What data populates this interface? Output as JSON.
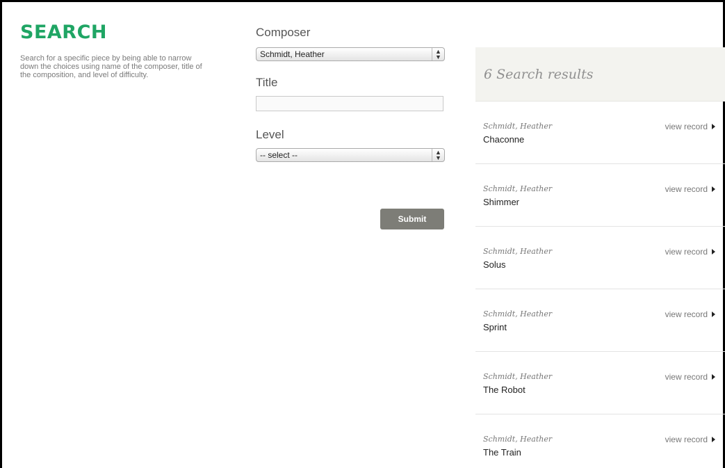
{
  "intro": {
    "heading": "SEARCH",
    "description": "Search for a specific piece by being able to narrow down the choices using name of the composer, title of the composition, and level of difficulty."
  },
  "form": {
    "composer_label": "Composer",
    "composer_value": "Schmidt, Heather",
    "title_label": "Title",
    "title_value": "",
    "level_label": "Level",
    "level_value": "-- select --",
    "submit_label": "Submit"
  },
  "results": {
    "count_text": "6 Search results",
    "view_label": "view record",
    "items": [
      {
        "composer": "Schmidt, Heather",
        "title": "Chaconne"
      },
      {
        "composer": "Schmidt, Heather",
        "title": "Shimmer"
      },
      {
        "composer": "Schmidt, Heather",
        "title": "Solus"
      },
      {
        "composer": "Schmidt, Heather",
        "title": "Sprint"
      },
      {
        "composer": "Schmidt, Heather",
        "title": "The Robot"
      },
      {
        "composer": "Schmidt, Heather",
        "title": "The Train"
      }
    ]
  },
  "colors": {
    "heading": "#1fa564",
    "submit_bg": "#7d7d77",
    "results_header_bg": "#f3f3ef"
  }
}
